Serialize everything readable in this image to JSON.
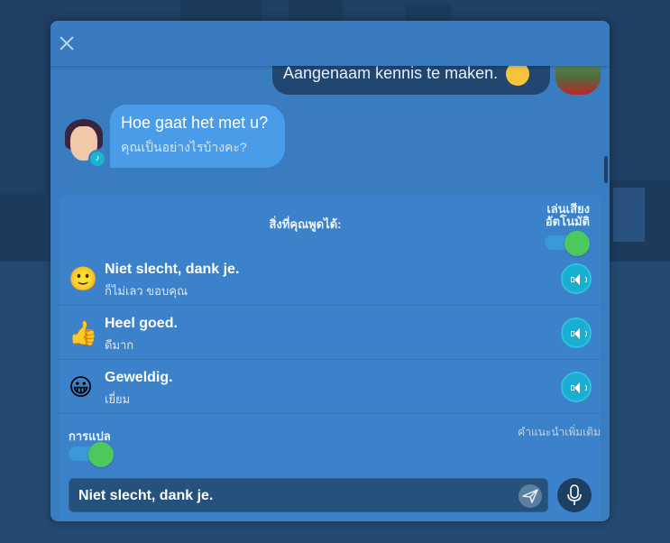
{
  "chat": {
    "user_message": "Aangenaam kennis te maken.",
    "bot_message_nl": "Hoe gaat het met u?",
    "bot_message_th": "คุณเป็นอย่างไรบ้างคะ?"
  },
  "options_panel": {
    "title": "สิ่งที่คุณพูดได้:",
    "autoplay_label_line1": "เล่นเสียง",
    "autoplay_label_line2": "อัตโนมัติ",
    "autoplay_on": true,
    "items": [
      {
        "emoji": "🙂",
        "icon": "slightly-smiling-face-emoji",
        "nl": "Niet slecht, dank je.",
        "th": "ก็ไม่เลว ขอบคุณ"
      },
      {
        "emoji": "👍",
        "icon": "thumbs-up-emoji",
        "nl": "Heel goed.",
        "th": "ดีมาก"
      },
      {
        "emoji": "😀",
        "icon": "grinning-face-emoji",
        "nl": "Geweldig.",
        "th": "เยี่ยม"
      }
    ],
    "translate_label": "การแปล",
    "translate_on": true,
    "more_tips": "คำแนะนำเพิ่มเติม"
  },
  "input": {
    "value": "Niet slecht, dank je."
  },
  "colors": {
    "panel": "#3a7cc0",
    "accent_toggle": "#4cc95c",
    "play_button": "#1aafd0"
  }
}
